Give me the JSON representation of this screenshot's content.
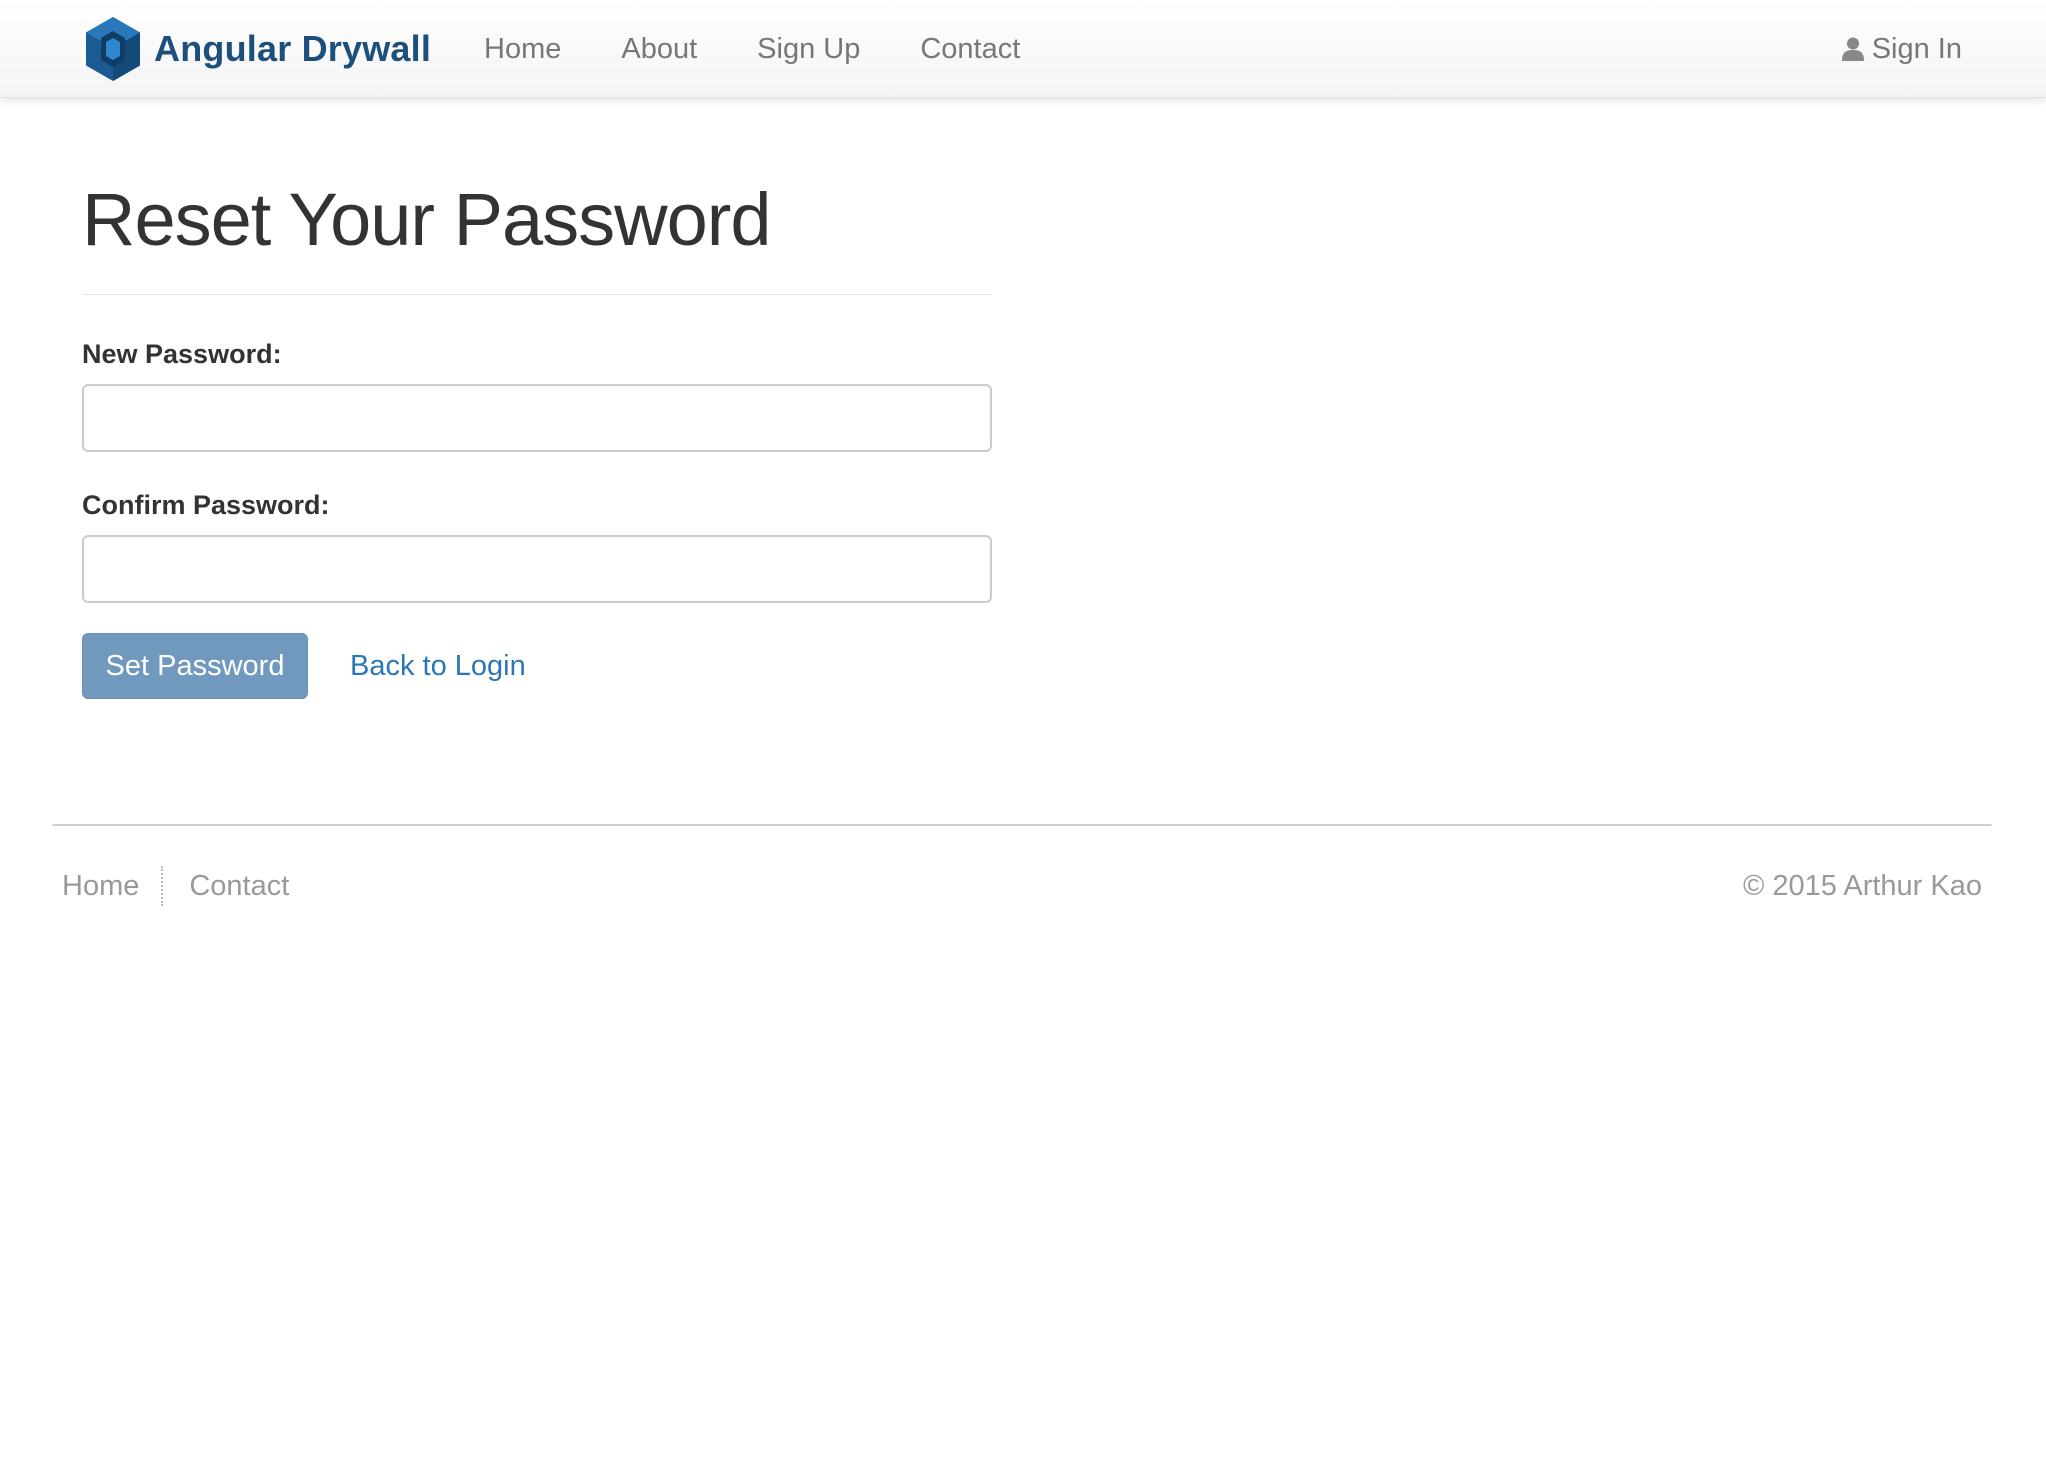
{
  "navbar": {
    "brand": "Angular Drywall",
    "links": [
      {
        "label": "Home"
      },
      {
        "label": "About"
      },
      {
        "label": "Sign Up"
      },
      {
        "label": "Contact"
      }
    ],
    "signin_label": "Sign In",
    "icons": {
      "logo": "hexagon-cube-logo",
      "user": "user-icon"
    }
  },
  "main": {
    "title": "Reset Your Password",
    "fields": [
      {
        "label": "New Password:",
        "value": "",
        "placeholder": ""
      },
      {
        "label": "Confirm Password:",
        "value": "",
        "placeholder": ""
      }
    ],
    "submit_label": "Set Password",
    "back_link": "Back to Login"
  },
  "footer": {
    "links": [
      {
        "label": "Home"
      },
      {
        "label": "Contact"
      }
    ],
    "copyright": "© 2015 Arthur Kao"
  },
  "colors": {
    "brand": "#1d4f7c",
    "button": "#7099bd",
    "link": "#2d76b6",
    "nav_text": "#777777",
    "footer_text": "#999999"
  }
}
